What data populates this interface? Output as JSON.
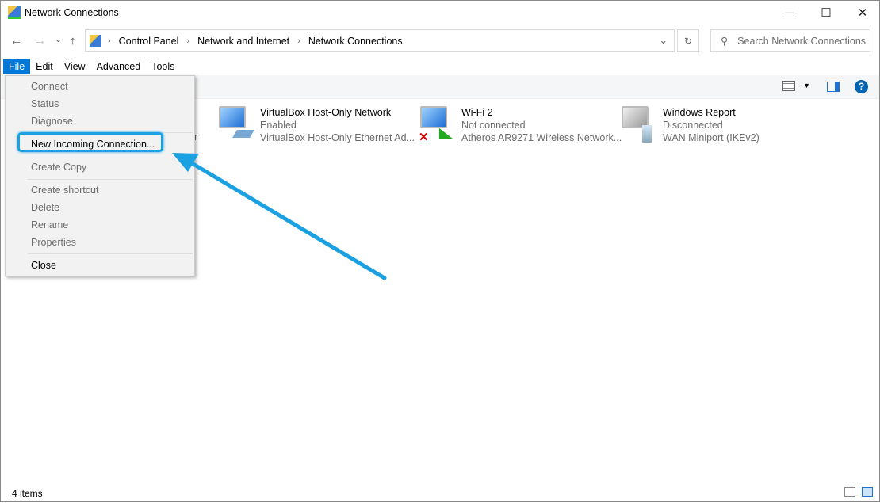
{
  "window": {
    "title": "Network Connections",
    "minimize": "─",
    "maximize": "☐",
    "close": "✕"
  },
  "nav": {
    "back": "←",
    "forward": "→",
    "recent": "⌄",
    "up": "↑",
    "refresh": "↻",
    "dropdown": "⌄"
  },
  "breadcrumb": [
    "Control Panel",
    "Network and Internet",
    "Network Connections"
  ],
  "search": {
    "placeholder": "Search Network Connections",
    "icon": "⚲"
  },
  "menubar": [
    "File",
    "Edit",
    "View",
    "Advanced",
    "Tools"
  ],
  "file_menu": {
    "items": [
      "Connect",
      "Status",
      "Diagnose",
      "New Incoming Connection...",
      "Create Copy",
      "Create shortcut",
      "Delete",
      "Rename",
      "Properties",
      "Close"
    ]
  },
  "connections": [
    {
      "partial": "er"
    },
    {
      "name": "VirtualBox Host-Only Network",
      "status": "Enabled",
      "device": "VirtualBox Host-Only Ethernet Ad..."
    },
    {
      "name": "Wi-Fi 2",
      "status": "Not connected",
      "device": "Atheros AR9271 Wireless Network..."
    },
    {
      "name": "Windows Report",
      "status": "Disconnected",
      "device": "WAN Miniport (IKEv2)"
    }
  ],
  "status_bar": {
    "count": "4 items"
  },
  "colors": {
    "accent": "#0078d7",
    "highlight": "#1ba1e2"
  }
}
